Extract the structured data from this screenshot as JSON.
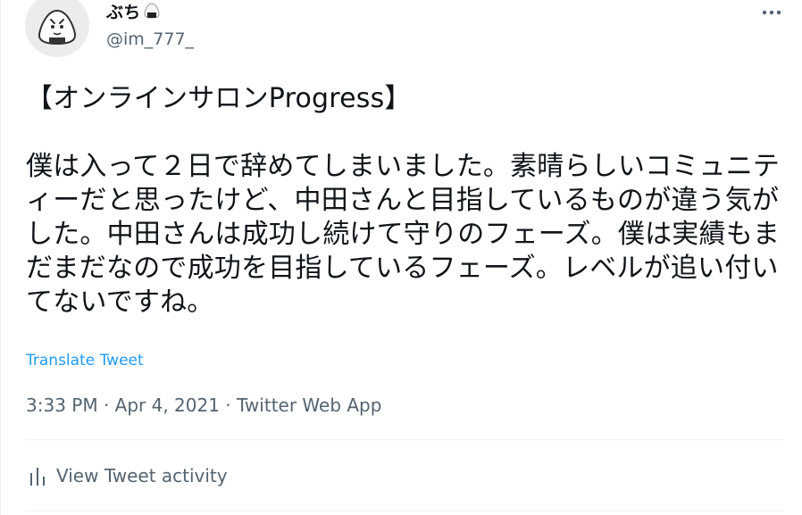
{
  "tweet": {
    "author": {
      "display_name": "ぶち",
      "name_emoji_icon": "onigiri-icon",
      "handle": "@im_777_",
      "avatar_icon": "onigiri-face-avatar"
    },
    "more_icon": "more-horizontal-icon",
    "text": "【オンラインサロンProgress】\n\n僕は入って２日で辞めてしまいました。素晴らしいコミュニティーだと思ったけど、中田さんと目指しているものが違う気がした。中田さんは成功し続けて守りのフェーズ。僕は実績もまだまだなので成功を目指しているフェーズ。レベルが追い付いてないですね。",
    "translate_label": "Translate Tweet",
    "timestamp": "3:33 PM · Apr 4, 2021 · Twitter Web App",
    "activity_label": "View Tweet activity",
    "activity_icon": "analytics-bars-icon"
  },
  "colors": {
    "link": "#1d9bf0",
    "secondary_text": "#536471",
    "primary_text": "#0f1419",
    "divider": "#eff3f4"
  }
}
